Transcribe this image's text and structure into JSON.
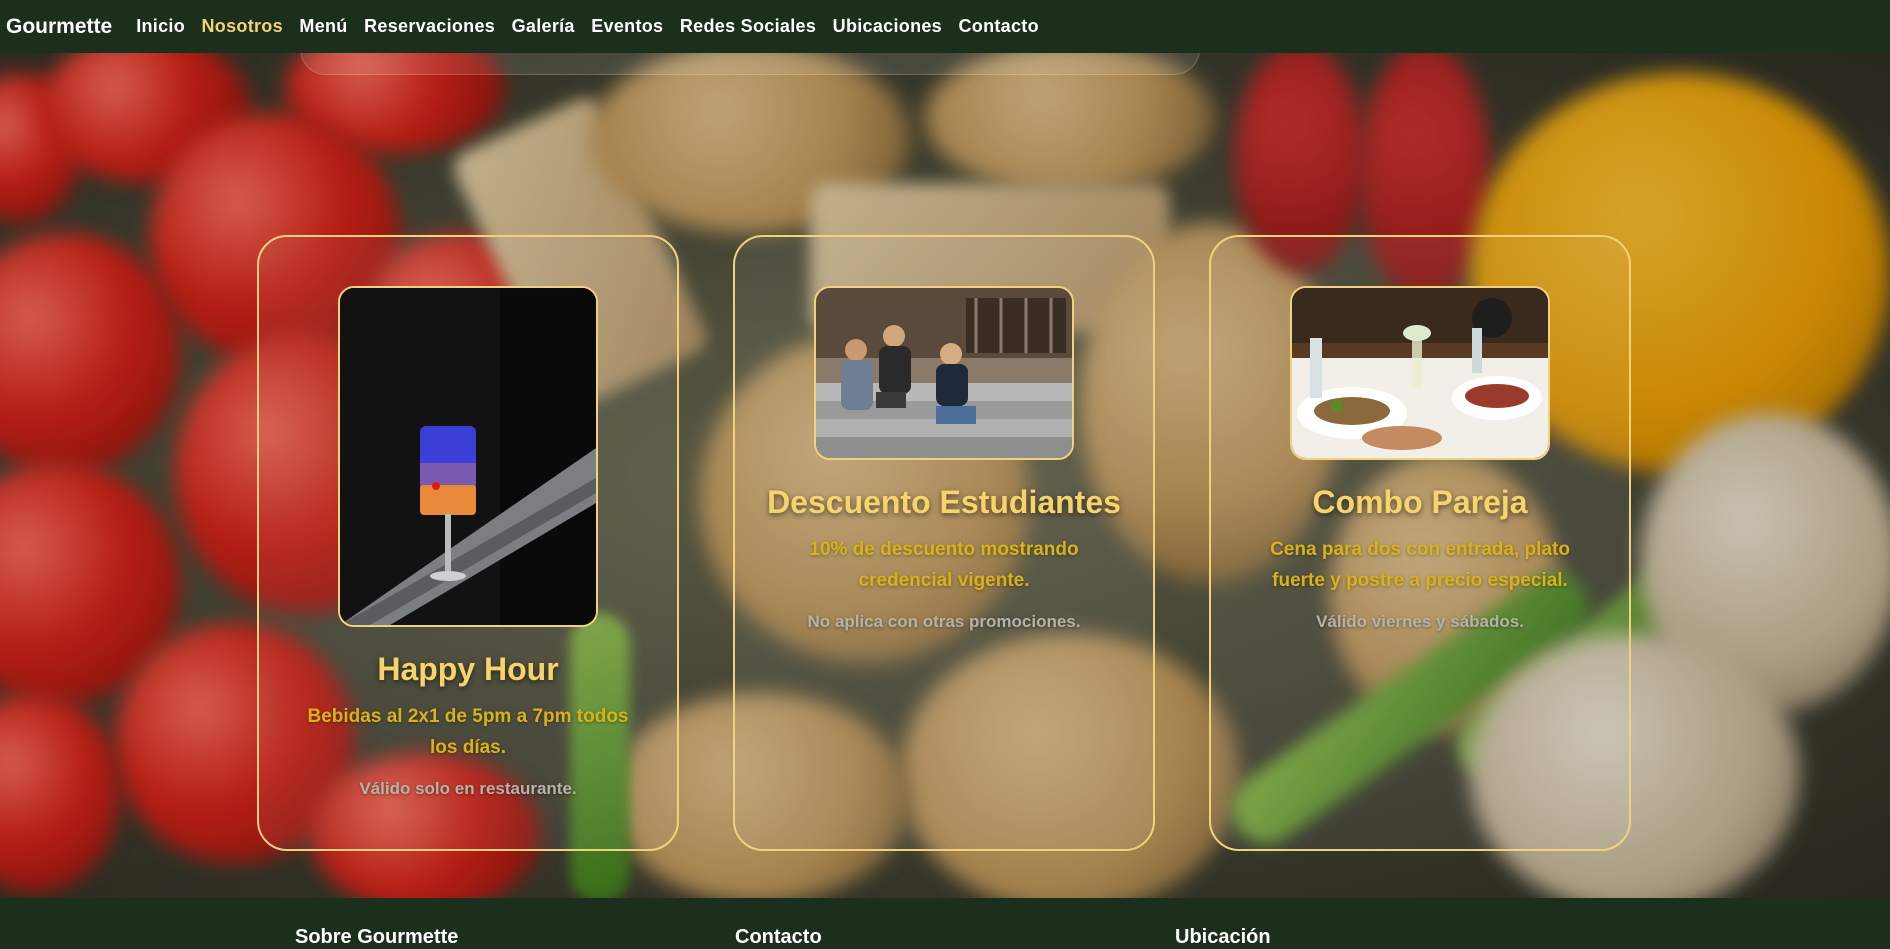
{
  "brand": "Gourmette",
  "nav": {
    "items": [
      "Inicio",
      "Nosotros",
      "Menú",
      "Reservaciones",
      "Galería",
      "Eventos",
      "Redes Sociales",
      "Ubicaciones",
      "Contacto"
    ],
    "active": "Nosotros"
  },
  "promos": [
    {
      "title": "Happy Hour",
      "description": "Bebidas al 2x1 de 5pm a 7pm todos los días.",
      "note": "Válido solo en restaurante."
    },
    {
      "title": "Descuento Estudiantes",
      "description": "10% de descuento mostrando credencial vigente.",
      "note": "No aplica con otras promociones."
    },
    {
      "title": "Combo Pareja",
      "description": "Cena para dos con entrada, plato fuerte y postre a precio especial.",
      "note": "Válido viernes y sábados."
    }
  ],
  "footer": {
    "col1": "Sobre Gourmette",
    "col2": "Contacto",
    "col3": "Ubicación"
  },
  "colors": {
    "nav_bg": "#1c2e1c",
    "accent_gold": "#f0d27e",
    "title_gold": "#f6d36b",
    "desc_gold": "#d8b21a"
  }
}
